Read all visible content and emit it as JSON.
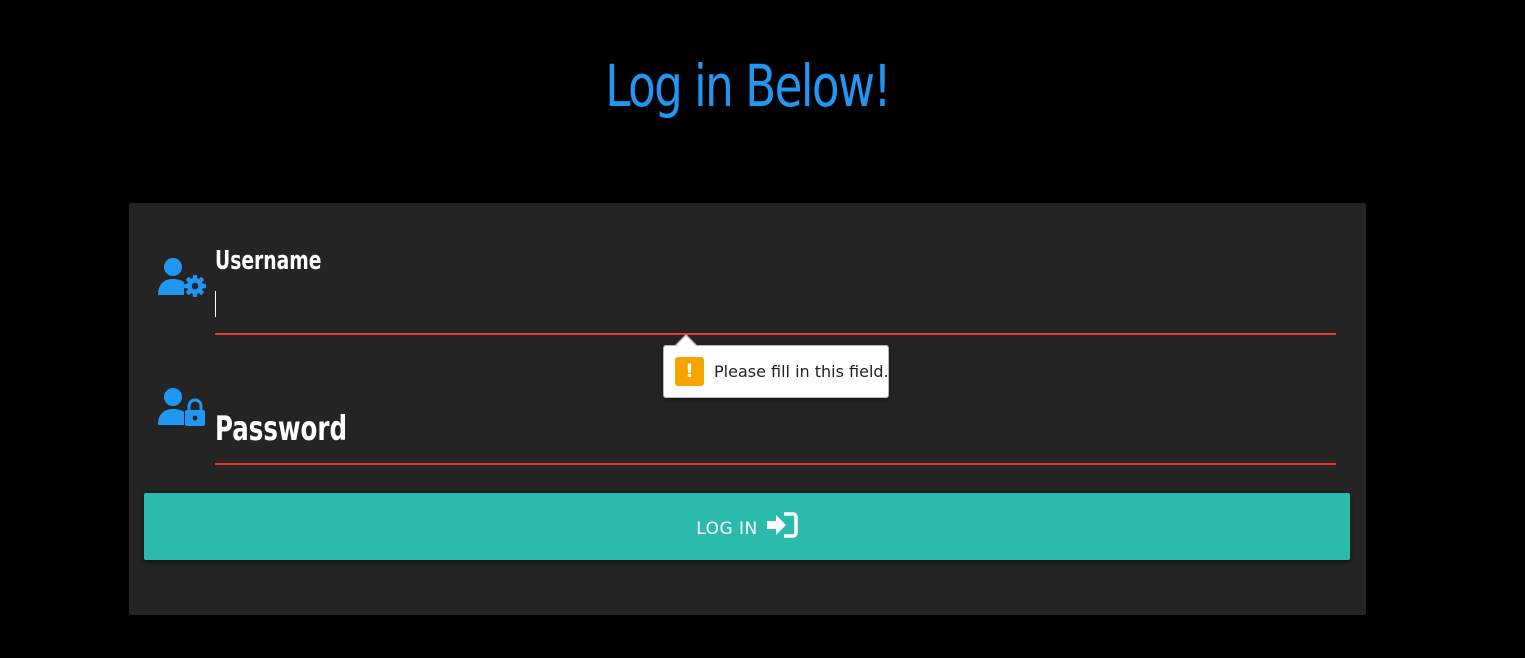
{
  "page": {
    "title": "Log in Below!"
  },
  "form": {
    "username": {
      "label": "Username",
      "value": "",
      "icon": "user-cog-icon"
    },
    "password": {
      "label": "Password",
      "value": "",
      "icon": "user-lock-icon"
    },
    "submit": {
      "label": "LOG IN",
      "icon": "sign-in-icon"
    }
  },
  "validation": {
    "message": "Please fill in this field.",
    "icon": "warning-icon",
    "symbol": "!"
  },
  "colors": {
    "accent": "#2196f3",
    "button": "#2bbbad",
    "error_underline": "#e53935",
    "card": "#242424",
    "background": "#000000",
    "warning": "#f7a400"
  }
}
